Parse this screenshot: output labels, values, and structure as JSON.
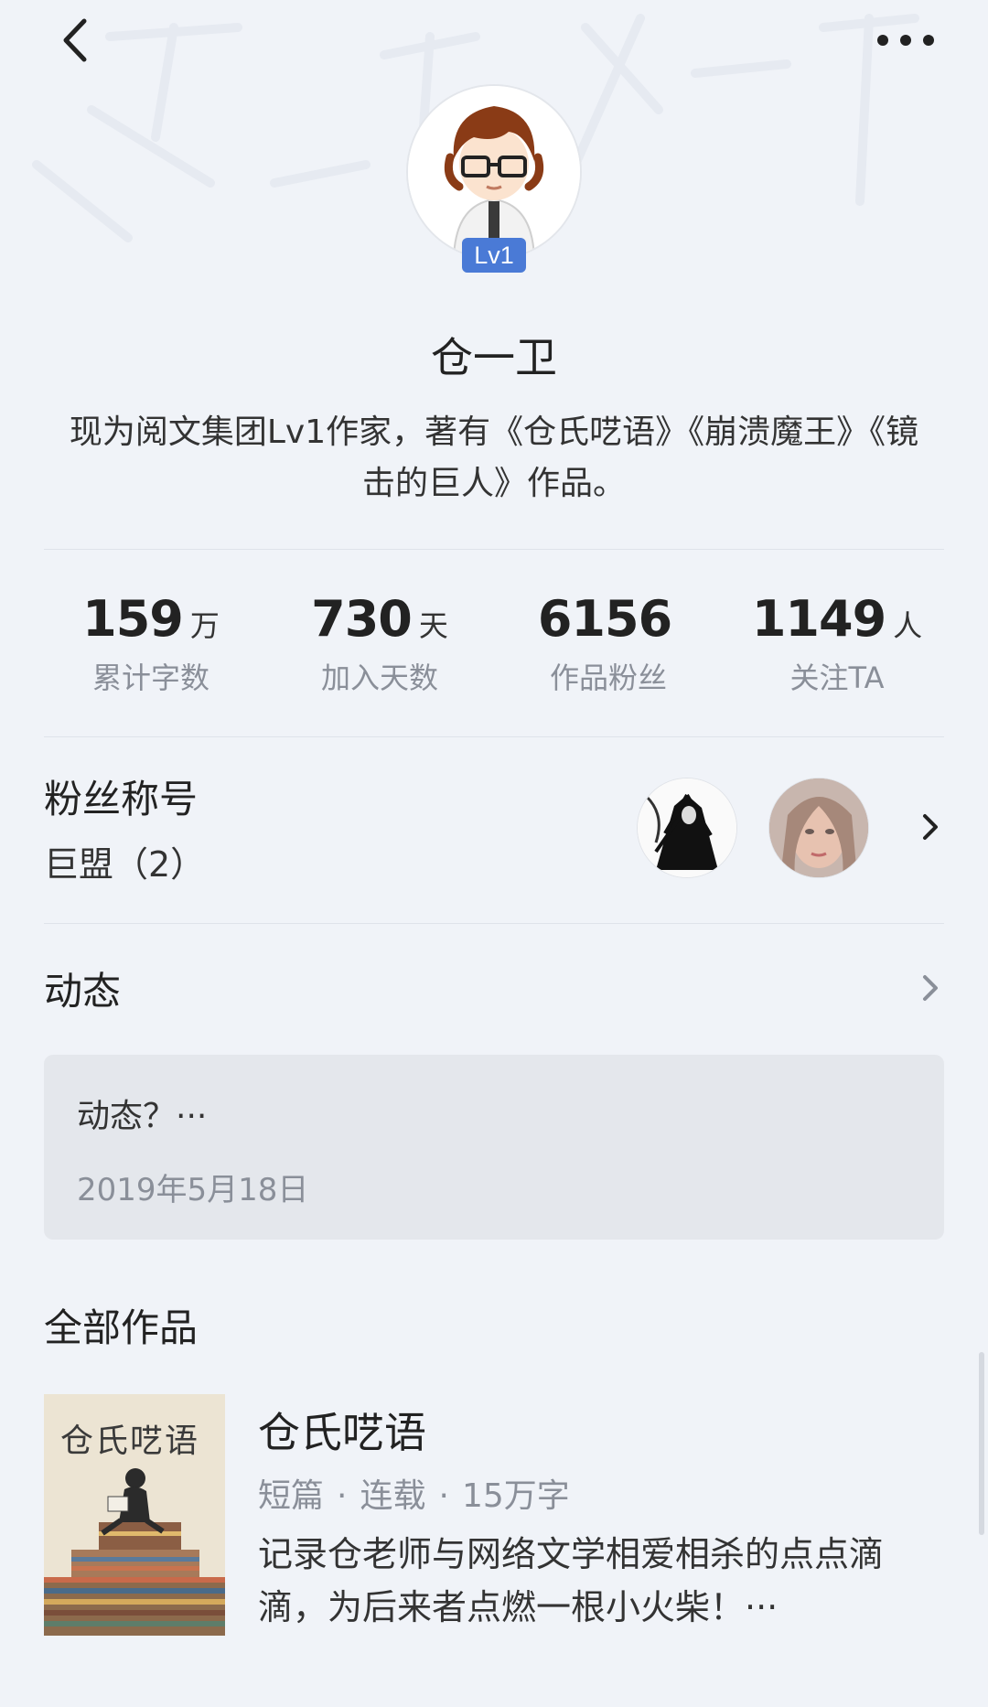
{
  "header": {
    "back_icon": "chevron-left-icon",
    "more_icon": "more-horizontal-icon"
  },
  "profile": {
    "level": "Lv1",
    "name": "仓一卫",
    "bio": "现为阅文集团Lv1作家，著有《仓氏呓语》《崩溃魔王》《镜击的巨人》作品。",
    "accent_color": "#4a7ad6"
  },
  "stats": [
    {
      "value": "159",
      "unit": "万",
      "label": "累计字数"
    },
    {
      "value": "730",
      "unit": "天",
      "label": "加入天数"
    },
    {
      "value": "6156",
      "unit": "",
      "label": "作品粉丝"
    },
    {
      "value": "1149",
      "unit": "人",
      "label": "关注TA"
    }
  ],
  "fans": {
    "title": "粉丝称号",
    "value": "巨盟（2）"
  },
  "dynamic": {
    "title": "动态",
    "text": "动态？···",
    "date": "2019年5月18日"
  },
  "works": {
    "title": "全部作品",
    "items": [
      {
        "cover_text": "仓氏呓语",
        "title": "仓氏呓语",
        "type": "短篇",
        "status": "连载",
        "words": "15万字",
        "desc": "记录仓老师与网络文学相爱相杀的点点滴滴，为后来者点燃一根小火柴！···"
      }
    ]
  }
}
